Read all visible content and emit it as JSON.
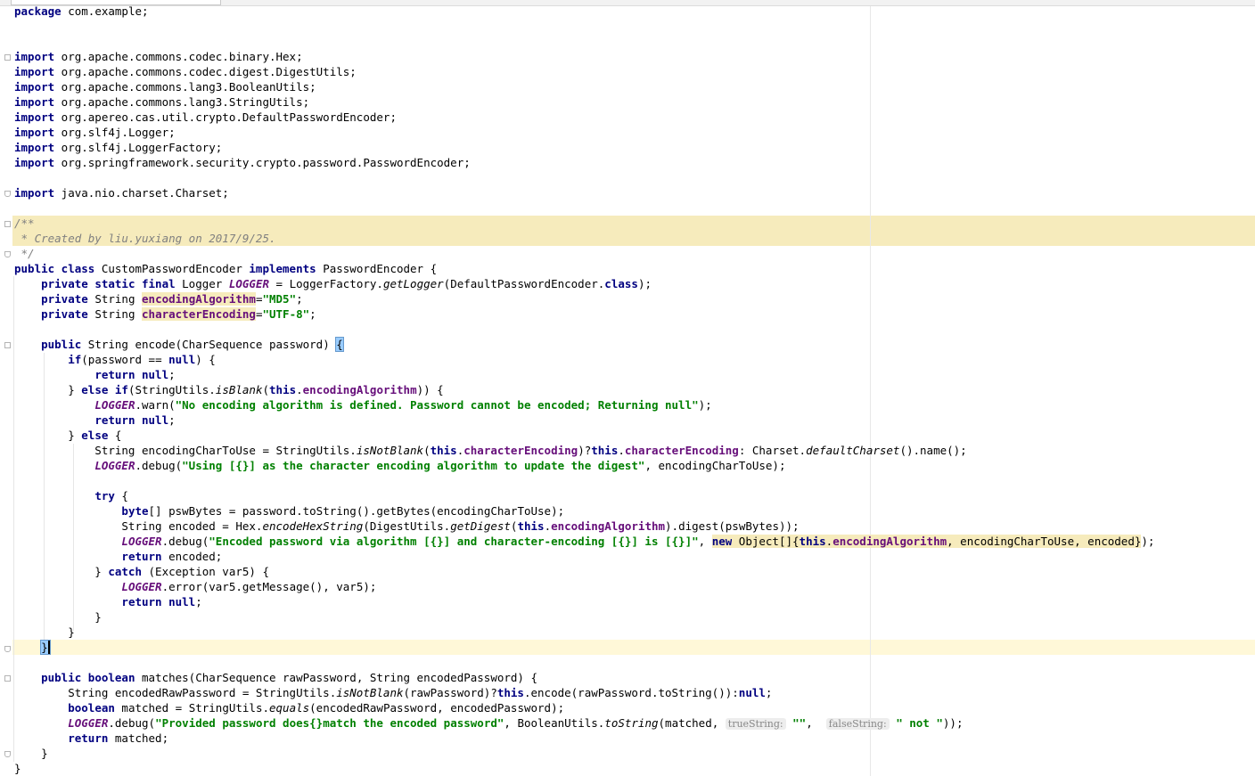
{
  "editor": {
    "lines": [
      {
        "t": [
          [
            "package",
            "kw-plain"
          ],
          [
            " com.example;",
            ""
          ]
        ]
      },
      {
        "t": []
      },
      {
        "t": []
      },
      {
        "t": [
          [
            "import",
            "kw"
          ],
          [
            " org.apache.commons.codec.binary.Hex;",
            ""
          ]
        ]
      },
      {
        "t": [
          [
            "import",
            "kw"
          ],
          [
            " org.apache.commons.codec.digest.DigestUtils;",
            ""
          ]
        ]
      },
      {
        "t": [
          [
            "import",
            "kw"
          ],
          [
            " org.apache.commons.lang3.BooleanUtils;",
            ""
          ]
        ]
      },
      {
        "t": [
          [
            "import",
            "kw"
          ],
          [
            " org.apache.commons.lang3.StringUtils;",
            ""
          ]
        ]
      },
      {
        "t": [
          [
            "import",
            "kw"
          ],
          [
            " org.apereo.cas.util.crypto.DefaultPasswordEncoder;",
            ""
          ]
        ]
      },
      {
        "t": [
          [
            "import",
            "kw"
          ],
          [
            " org.slf4j.Logger;",
            ""
          ]
        ]
      },
      {
        "t": [
          [
            "import",
            "kw"
          ],
          [
            " org.slf4j.LoggerFactory;",
            ""
          ]
        ]
      },
      {
        "t": [
          [
            "import",
            "kw"
          ],
          [
            " org.springframework.security.crypto.password.PasswordEncoder;",
            ""
          ]
        ]
      },
      {
        "t": []
      },
      {
        "t": [
          [
            "import",
            "kw"
          ],
          [
            " java.nio.charset.Charset;",
            ""
          ]
        ]
      },
      {
        "t": []
      },
      {
        "t": [
          [
            "/**",
            "cmt"
          ]
        ]
      },
      {
        "t": [
          [
            " * Created by liu.yuxiang on 2017/9/25.",
            "cmt"
          ]
        ]
      },
      {
        "t": [
          [
            " */",
            "cmt"
          ]
        ]
      },
      {
        "t": [
          [
            "public class",
            "kw"
          ],
          [
            " CustomPasswordEncoder ",
            ""
          ],
          [
            "implements",
            "kw"
          ],
          [
            " PasswordEncoder {",
            ""
          ]
        ]
      },
      {
        "t": [
          [
            "    ",
            ""
          ],
          [
            "private static final",
            "kw"
          ],
          [
            " Logger ",
            ""
          ],
          [
            "LOGGER",
            "stat"
          ],
          [
            " = LoggerFactory.",
            ""
          ],
          [
            "getLogger",
            "it"
          ],
          [
            "(DefaultPasswordEncoder.",
            ""
          ],
          [
            "class",
            "kw"
          ],
          [
            ");",
            ""
          ]
        ]
      },
      {
        "t": [
          [
            "    ",
            ""
          ],
          [
            "private",
            "kw"
          ],
          [
            " String ",
            ""
          ],
          [
            "encodingAlgorithm",
            "fld hlw"
          ],
          [
            "=",
            ""
          ],
          [
            "\"MD5\"",
            "str"
          ],
          [
            ";",
            ""
          ]
        ]
      },
      {
        "t": [
          [
            "    ",
            ""
          ],
          [
            "private",
            "kw"
          ],
          [
            " String ",
            ""
          ],
          [
            "characterEncoding",
            "fld hlw"
          ],
          [
            "=",
            ""
          ],
          [
            "\"UTF-8\"",
            "str"
          ],
          [
            ";",
            ""
          ]
        ]
      },
      {
        "t": []
      },
      {
        "t": [
          [
            "    ",
            ""
          ],
          [
            "public",
            "kw"
          ],
          [
            " String encode(CharSequence password) ",
            ""
          ],
          [
            "{",
            "brace"
          ]
        ]
      },
      {
        "t": [
          [
            "        ",
            ""
          ],
          [
            "if",
            "kw"
          ],
          [
            "(password == ",
            ""
          ],
          [
            "null",
            "kw"
          ],
          [
            ") {",
            ""
          ]
        ]
      },
      {
        "t": [
          [
            "            ",
            ""
          ],
          [
            "return null",
            "kw"
          ],
          [
            ";",
            ""
          ]
        ]
      },
      {
        "t": [
          [
            "        } ",
            ""
          ],
          [
            "else if",
            "kw"
          ],
          [
            "(StringUtils.",
            ""
          ],
          [
            "isBlank",
            "it"
          ],
          [
            "(",
            ""
          ],
          [
            "this",
            "kw"
          ],
          [
            ".",
            ""
          ],
          [
            "encodingAlgorithm",
            "fld"
          ],
          [
            ")) {",
            ""
          ]
        ]
      },
      {
        "t": [
          [
            "            ",
            ""
          ],
          [
            "LOGGER",
            "stat"
          ],
          [
            ".warn(",
            ""
          ],
          [
            "\"No encoding algorithm is defined. Password cannot be encoded; Returning null\"",
            "str"
          ],
          [
            ");",
            ""
          ]
        ]
      },
      {
        "t": [
          [
            "            ",
            ""
          ],
          [
            "return null",
            "kw"
          ],
          [
            ";",
            ""
          ]
        ]
      },
      {
        "t": [
          [
            "        } ",
            ""
          ],
          [
            "else",
            "kw"
          ],
          [
            " {",
            ""
          ]
        ]
      },
      {
        "t": [
          [
            "            String encodingCharToUse = StringUtils.",
            ""
          ],
          [
            "isNotBlank",
            "it"
          ],
          [
            "(",
            ""
          ],
          [
            "this",
            "kw"
          ],
          [
            ".",
            ""
          ],
          [
            "characterEncoding",
            "fld"
          ],
          [
            ")?",
            ""
          ],
          [
            "this",
            "kw"
          ],
          [
            ".",
            ""
          ],
          [
            "characterEncoding",
            "fld"
          ],
          [
            ": Charset.",
            ""
          ],
          [
            "defaultCharset",
            "it"
          ],
          [
            "().name();",
            ""
          ]
        ]
      },
      {
        "t": [
          [
            "            ",
            ""
          ],
          [
            "LOGGER",
            "stat"
          ],
          [
            ".debug(",
            ""
          ],
          [
            "\"Using [{}] as the character encoding algorithm to update the digest\"",
            "str"
          ],
          [
            ", encodingCharToUse);",
            ""
          ]
        ]
      },
      {
        "t": []
      },
      {
        "t": [
          [
            "            ",
            ""
          ],
          [
            "try",
            "kw"
          ],
          [
            " {",
            ""
          ]
        ]
      },
      {
        "t": [
          [
            "                ",
            ""
          ],
          [
            "byte",
            "kw"
          ],
          [
            "[] pswBytes = password.toString().getBytes(encodingCharToUse);",
            ""
          ]
        ]
      },
      {
        "t": [
          [
            "                String encoded = Hex.",
            ""
          ],
          [
            "encodeHexString",
            "it"
          ],
          [
            "(DigestUtils.",
            ""
          ],
          [
            "getDigest",
            "it"
          ],
          [
            "(",
            ""
          ],
          [
            "this",
            "kw"
          ],
          [
            ".",
            ""
          ],
          [
            "encodingAlgorithm",
            "fld"
          ],
          [
            ").digest(pswBytes));",
            ""
          ]
        ]
      },
      {
        "t": [
          [
            "                ",
            ""
          ],
          [
            "LOGGER",
            "stat"
          ],
          [
            ".debug(",
            ""
          ],
          [
            "\"Encoded password via algorithm [{}] and character-encoding [{}] is [{}]\"",
            "str"
          ],
          [
            ", ",
            ""
          ],
          [
            "new",
            "kw hlw"
          ],
          [
            " Object[]{",
            "hlw"
          ],
          [
            "this",
            "kw hlw"
          ],
          [
            ".",
            "hlw"
          ],
          [
            "encodingAlgorithm",
            "fld hlw"
          ],
          [
            ", encodingCharToUse, encoded}",
            "hlw"
          ],
          [
            ");",
            ""
          ]
        ]
      },
      {
        "t": [
          [
            "                ",
            ""
          ],
          [
            "return",
            "kw"
          ],
          [
            " encoded;",
            ""
          ]
        ]
      },
      {
        "t": [
          [
            "            } ",
            ""
          ],
          [
            "catch",
            "kw"
          ],
          [
            " (Exception var5) {",
            ""
          ]
        ]
      },
      {
        "t": [
          [
            "                ",
            ""
          ],
          [
            "LOGGER",
            "stat"
          ],
          [
            ".error(var5.getMessage(), var5);",
            ""
          ]
        ]
      },
      {
        "t": [
          [
            "                ",
            ""
          ],
          [
            "return null",
            "kw"
          ],
          [
            ";",
            ""
          ]
        ]
      },
      {
        "t": [
          [
            "            }",
            ""
          ]
        ]
      },
      {
        "t": [
          [
            "        }",
            ""
          ]
        ]
      },
      {
        "t": [
          [
            "    ",
            ""
          ],
          [
            "}",
            "brace caret"
          ]
        ]
      },
      {
        "t": []
      },
      {
        "t": [
          [
            "    ",
            ""
          ],
          [
            "public boolean",
            "kw"
          ],
          [
            " matches(CharSequence rawPassword, String encodedPassword) {",
            ""
          ]
        ]
      },
      {
        "t": [
          [
            "        String encodedRawPassword = StringUtils.",
            ""
          ],
          [
            "isNotBlank",
            "it"
          ],
          [
            "(rawPassword)?",
            ""
          ],
          [
            "this",
            "kw"
          ],
          [
            ".encode(rawPassword.toString()):",
            ""
          ],
          [
            "null",
            "kw"
          ],
          [
            ";",
            ""
          ]
        ]
      },
      {
        "t": [
          [
            "        ",
            ""
          ],
          [
            "boolean",
            "kw"
          ],
          [
            " matched = StringUtils.",
            ""
          ],
          [
            "equals",
            "it"
          ],
          [
            "(encodedRawPassword, encodedPassword);",
            ""
          ]
        ]
      },
      {
        "t": [
          [
            "        ",
            ""
          ],
          [
            "LOGGER",
            "stat"
          ],
          [
            ".debug(",
            ""
          ],
          [
            "\"Provided password does{}match the encoded password\"",
            "str"
          ],
          [
            ", BooleanUtils.",
            ""
          ],
          [
            "toString",
            "it"
          ],
          [
            "(matched, ",
            ""
          ],
          [
            "trueString:",
            "hint"
          ],
          [
            " ",
            ""
          ],
          [
            "\"\"",
            "str"
          ],
          [
            ",  ",
            ""
          ],
          [
            "falseString:",
            "hint"
          ],
          [
            " ",
            ""
          ],
          [
            "\" not \"",
            "str"
          ],
          [
            "));",
            ""
          ]
        ]
      },
      {
        "t": [
          [
            "        ",
            ""
          ],
          [
            "return",
            "kw"
          ],
          [
            " matched;",
            ""
          ]
        ]
      },
      {
        "t": [
          [
            "    }",
            ""
          ]
        ]
      },
      {
        "t": [
          [
            "}",
            ""
          ]
        ]
      }
    ]
  }
}
